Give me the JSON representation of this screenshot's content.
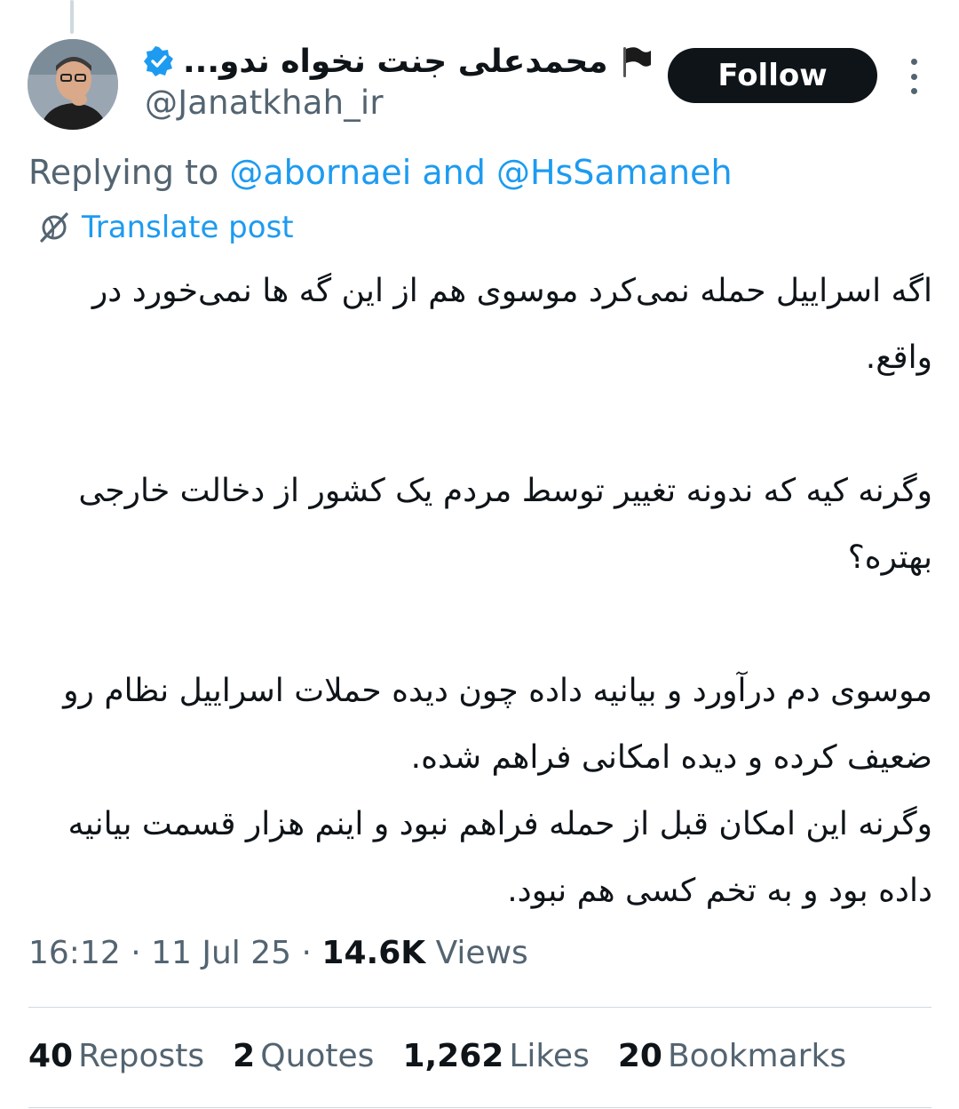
{
  "author": {
    "display_name": "محمدعلی جنت نخواه ندو...",
    "handle": "@Janatkhah_ir",
    "verified": true,
    "flag_icon": "black-flag-icon"
  },
  "actions": {
    "follow_label": "Follow",
    "more_icon": "more-options-icon"
  },
  "reply_context": {
    "prefix": "Replying to",
    "mention_1": "@abornaei",
    "joiner": "and",
    "mention_2": "@HsSamaneh"
  },
  "translate": {
    "label": "Translate post",
    "icon": "globe-slash-icon"
  },
  "post": {
    "paragraphs": [
      "اگه اسراییل حمله نمی‌کرد موسوی هم از این گه ها نمی‌خورد در واقع.",
      "وگرنه کیه که ندونه تغییر توسط مردم یک کشور از دخالت خارجی بهتره؟",
      "موسوی دم درآورد و بیانیه داده چون دیده حملات اسراییل نظام رو ضعیف کرده و دیده امکانی فراهم شده.\nوگرنه این امکان قبل از حمله فراهم نبود و اینم هزار قسمت بیانیه داده بود و به تخم کسی هم نبود."
    ]
  },
  "meta": {
    "time": "16:12",
    "date": "11 Jul 25",
    "views_count": "14.6K",
    "views_label": "Views",
    "separator": "·"
  },
  "stats": [
    {
      "count": "40",
      "label": "Reposts"
    },
    {
      "count": "2",
      "label": "Quotes"
    },
    {
      "count": "1,262",
      "label": "Likes"
    },
    {
      "count": "20",
      "label": "Bookmarks"
    }
  ],
  "colors": {
    "accent": "#1d9bf0",
    "text_primary": "#0f1419",
    "text_secondary": "#536471",
    "divider": "#cfd9de",
    "follow_bg": "#0f1419"
  }
}
